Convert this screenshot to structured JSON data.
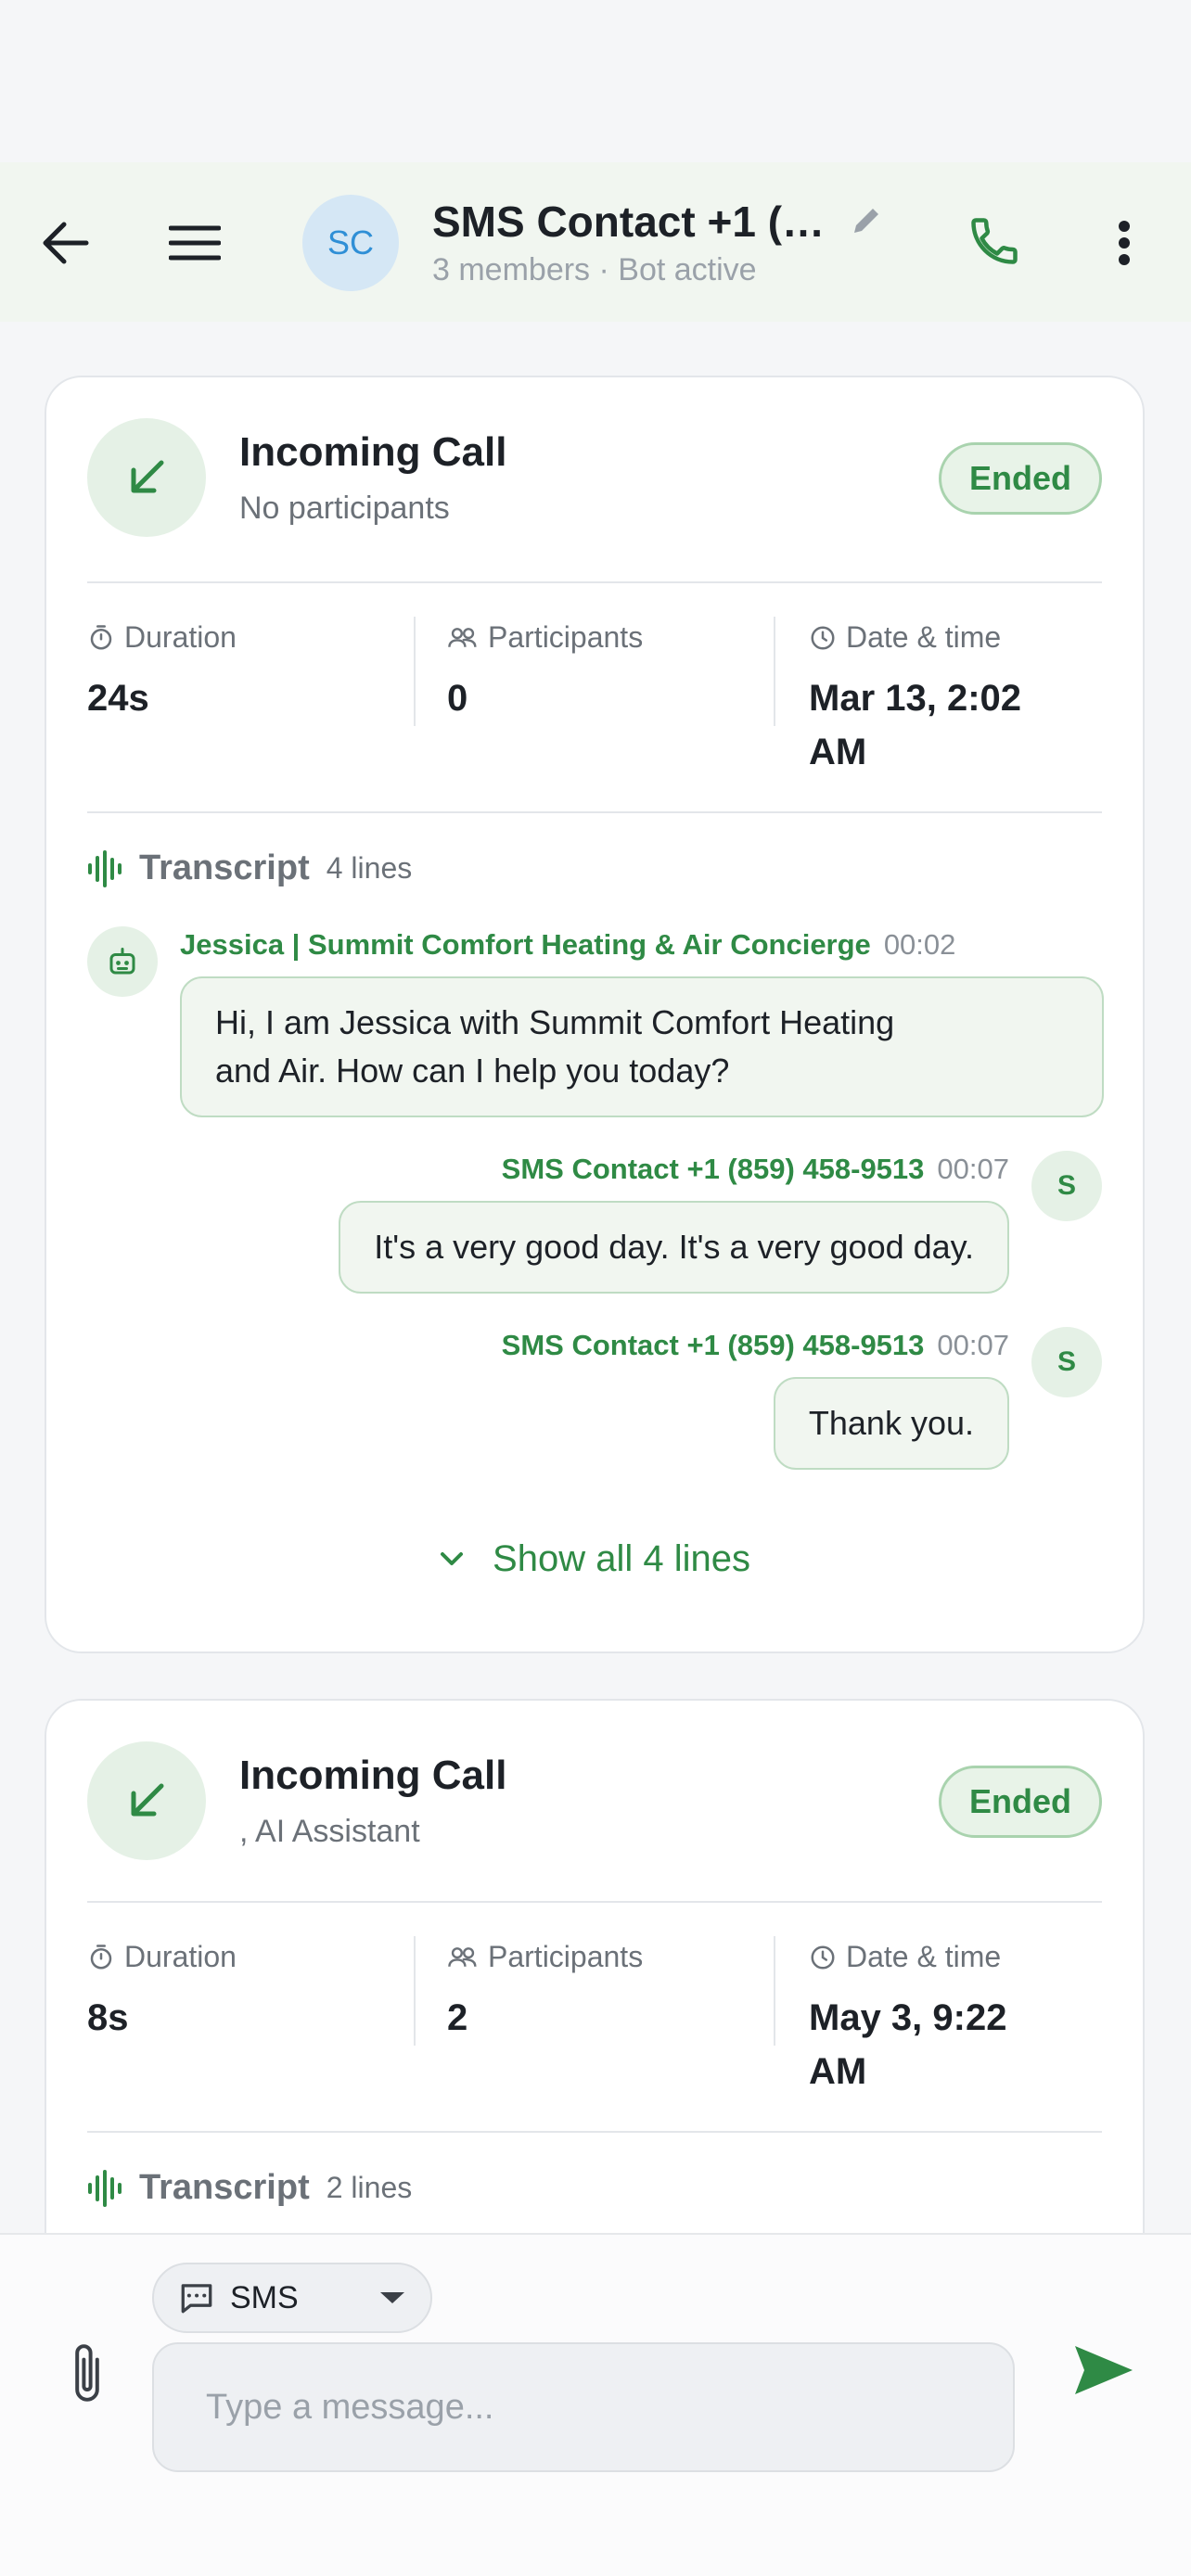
{
  "header": {
    "avatar_initials": "SC",
    "title": "SMS Contact +1 (…",
    "subtitle": "3 members · Bot active"
  },
  "calls": [
    {
      "title": "Incoming Call",
      "subtitle": "No participants",
      "status": "Ended",
      "stats": {
        "duration_label": "Duration",
        "duration_value": "24s",
        "participants_label": "Participants",
        "participants_value": "0",
        "datetime_label": "Date & time",
        "datetime_line1": "Mar 13, 2:02",
        "datetime_line2": "AM"
      },
      "transcript": {
        "title": "Transcript",
        "count": "4 lines",
        "messages": [
          {
            "speaker": "Jessica | Summit Comfort Heating & Air Concierge",
            "time": "00:02",
            "text_line1": "Hi, I am Jessica with Summit Comfort Heating",
            "text_line2": "and Air. How can I help you today?"
          },
          {
            "speaker": "SMS Contact +1 (859) 458-9513",
            "time": "00:07",
            "avatar": "S",
            "text": "It's a very good day. It's a very good day."
          },
          {
            "speaker": "SMS Contact +1 (859) 458-9513",
            "time": "00:07",
            "avatar": "S",
            "text": "Thank you."
          }
        ],
        "show_all": "Show all 4 lines"
      }
    },
    {
      "title": "Incoming Call",
      "subtitle": ", AI Assistant",
      "status": "Ended",
      "stats": {
        "duration_label": "Duration",
        "duration_value": "8s",
        "participants_label": "Participants",
        "participants_value": "2",
        "datetime_label": "Date & time",
        "datetime_line1": "May 3, 9:22",
        "datetime_line2": "AM"
      },
      "transcript": {
        "title": "Transcript",
        "count": "2 lines"
      }
    }
  ],
  "composer": {
    "channel": "SMS",
    "placeholder": "Type a message..."
  },
  "colors": {
    "accent": "#2f8a45",
    "header_bg": "#f1f6f0",
    "avatar_blue": "#2f8fd6"
  }
}
